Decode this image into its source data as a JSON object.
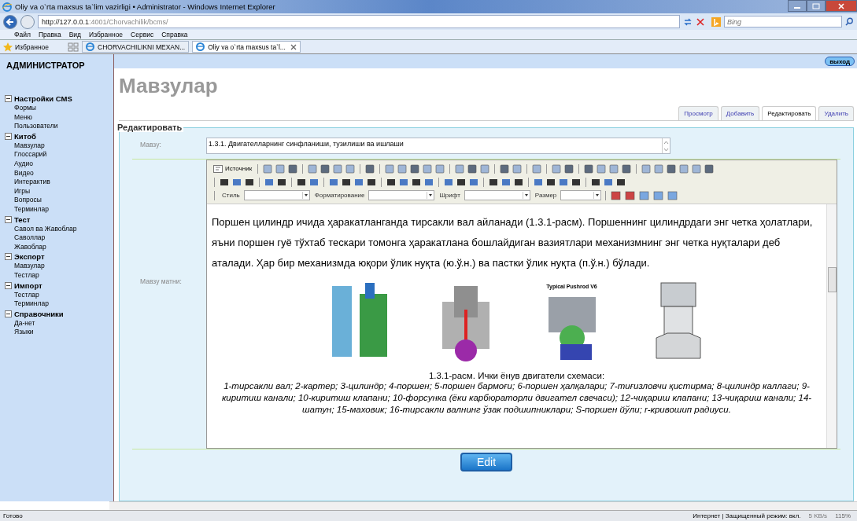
{
  "window": {
    "title": "Oliy va o`rta maxsus ta`lim vazirligi • Administrator - Windows Internet Explorer"
  },
  "address_bar": {
    "url_host": "http://127.0.0.1",
    "url_rest": ":4001/Chorvachilik/bcms/",
    "search_placeholder": "Bing"
  },
  "menu": [
    "Файл",
    "Правка",
    "Вид",
    "Избранное",
    "Сервис",
    "Справка"
  ],
  "favorites": {
    "label": "Избранное",
    "tabs": [
      {
        "label": "CHORVACHILIKNI MEXAN...",
        "selected": false
      },
      {
        "label": "Oliy va o`rta maxsus ta`l...",
        "selected": true
      }
    ]
  },
  "sidebar": {
    "title": "АДМИНИСТРАТОР",
    "groups": [
      {
        "label": "Настройки CMS",
        "expanded": true,
        "children": [
          {
            "label": "Формы"
          },
          {
            "label": "Меню"
          },
          {
            "label": "Пользователи"
          }
        ]
      },
      {
        "label": "Китоб",
        "expanded": true,
        "children": [
          {
            "label": "Мавзулар"
          },
          {
            "label": "Глоссарий"
          },
          {
            "label": "Аудио"
          },
          {
            "label": "Видео"
          },
          {
            "label": "Интерактив"
          },
          {
            "label": "Игры"
          },
          {
            "label": "Вопросы"
          },
          {
            "label": "Терминлар"
          }
        ]
      },
      {
        "label": "Тест",
        "expanded": true,
        "children": [
          {
            "label": "Савол ва Жавоблар"
          },
          {
            "label": "Саволлар"
          },
          {
            "label": "Жавоблар"
          }
        ]
      },
      {
        "label": "Экспорт",
        "expanded": true,
        "children": [
          {
            "label": "Мавзулар"
          },
          {
            "label": "Тестлар"
          }
        ]
      },
      {
        "label": "Импорт",
        "expanded": true,
        "children": [
          {
            "label": "Тестлар"
          },
          {
            "label": "Терминлар"
          }
        ]
      },
      {
        "label": "Справочники",
        "expanded": true,
        "children": [
          {
            "label": "Да-нет"
          },
          {
            "label": "Языки"
          }
        ]
      }
    ]
  },
  "logout": "выход",
  "page_title": "Мавзулар",
  "tabs": [
    {
      "label": "Просмотр",
      "selected": false
    },
    {
      "label": "Добавить",
      "selected": false
    },
    {
      "label": "Редактировать",
      "selected": true
    },
    {
      "label": "Удалить",
      "selected": false
    }
  ],
  "form": {
    "legend": "Редактировать",
    "topic_label": "Мавзу:",
    "topic_value": "1.3.1. Двигателларнинг синфланиши, тузилиши ва ишлаши",
    "text_label": "Мавзу матни:",
    "toolbar": {
      "source": "Источник",
      "style": "Стиль",
      "format": "Форматирование",
      "font": "Шрифт",
      "size": "Размер"
    },
    "paragraph": "Поршен цилиндр ичида ҳаракатланганда тирсакли вал айланади (1.3.1-расм). Поршеннинг цилиндрдаги энг четка ҳолатлари, яъни поршен гуё тўхтаб тескари томонга ҳаракатлана бошлайдиган вазиятлари механизмнинг энг четка нуқталари деб аталади. Ҳар бир механизмда юқори ўлик нуқта (ю.ў.н.) ва пастки ўлик нуқта (п.ў.н.) бўлади.",
    "figure_caption": "1.3.1-расм. Ички ёнув двигатели схемаси:",
    "figure_legend": "1-тирсакли вал; 2-картер; 3-цилиндр; 4-поршен; 5-поршен бармоғи; 6-поршен ҳалқалари; 7-тиғизловчи қистирма; 8-цилиндр каллаги; 9-киритиш канали; 10-киритиш клапани; 10-форсунка (ёки карбюраторли двигател свечаси); 12-чиқариш клапани; 13-чиқариш канали; 14-шатун; 15-маховик; 16-тирсакли валнинг ўзак подшипниклари; S-поршен йўли; r-кривошип радиуси.",
    "image_label": "Typical Pushrod V6",
    "submit": "Edit"
  },
  "status_bar": {
    "left": "Готово",
    "zone": "Интернет | Защищенный режим: вкл.",
    "speed": "5 KB/s",
    "zoom": "115%"
  }
}
